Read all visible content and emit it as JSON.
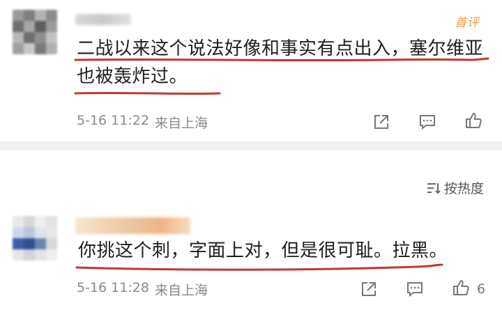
{
  "comments": [
    {
      "badge": "首评",
      "text_line1": "二战以来这个说法好像和事实有点出入，塞尔维亚",
      "text_line2": "也被轰炸过。",
      "time": "5-16 11:22",
      "location": "来自上海",
      "like_count": ""
    },
    {
      "text_line1": "你挑这个刺，字面上对，但是很可耻。拉黑。",
      "time": "5-16 11:28",
      "location": "来自上海",
      "like_count": "6"
    }
  ],
  "sort": {
    "label": "按热度"
  },
  "colors": {
    "underline": "#c0392b",
    "badge": "#f59a3a",
    "meta": "#8a8a8a"
  },
  "icons": [
    "share-icon",
    "comment-icon",
    "like-icon",
    "sort-icon"
  ]
}
